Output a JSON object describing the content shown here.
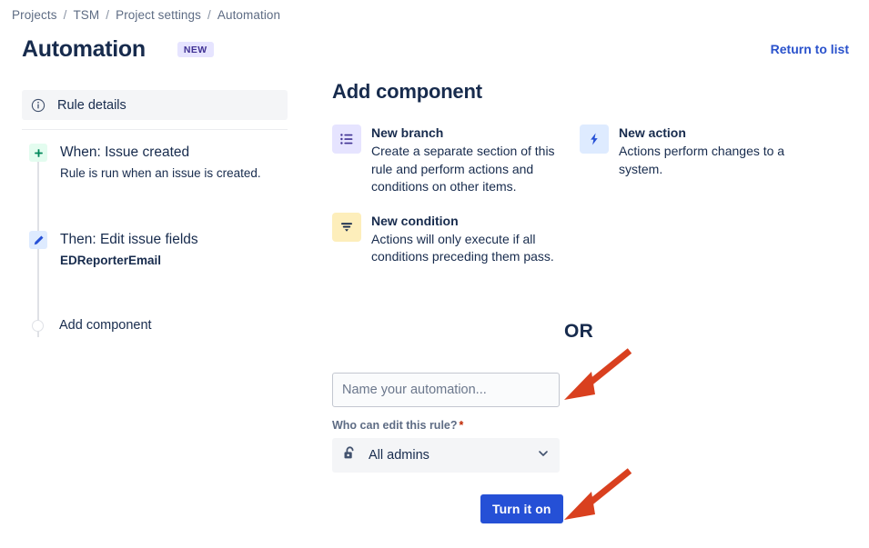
{
  "breadcrumb": {
    "items": [
      "Projects",
      "TSM",
      "Project settings",
      "Automation"
    ],
    "separator": "/"
  },
  "header": {
    "title": "Automation",
    "badge": "NEW",
    "return_link": "Return to list",
    "accent_link_color": "#2a52cc",
    "badge_bg": "#e6e4ff",
    "badge_fg": "#403294"
  },
  "left_panel": {
    "rule_details": {
      "label": "Rule details",
      "icon": "info-circle-icon"
    },
    "tree": [
      {
        "icon": "plus-icon",
        "badge_color": "#e3fcef",
        "title": "When: Issue created",
        "subtitle": "Rule is run when an issue is created.",
        "subtitle_bold": false
      },
      {
        "icon": "pencil-icon",
        "badge_color": "#deebff",
        "title": "Then: Edit issue fields",
        "subtitle": "EDReporterEmail",
        "subtitle_bold": true
      }
    ],
    "add_component_label": "Add component"
  },
  "right_panel": {
    "section_title": "Add component",
    "components": [
      {
        "name": "New branch",
        "description": "Create a separate section of this rule and perform actions and conditions on other items.",
        "icon": "list-branch-icon",
        "icon_bg": "#e6e4ff",
        "column": "left"
      },
      {
        "name": "New condition",
        "description": "Actions will only execute if all conditions preceding them pass.",
        "icon": "filter-funnel-icon",
        "icon_bg": "#fdeebb",
        "column": "left"
      },
      {
        "name": "New action",
        "description": "Actions perform changes to a system.",
        "icon": "lightning-bolt-icon",
        "icon_bg": "#deebff",
        "column": "right"
      }
    ],
    "or_label": "OR"
  },
  "form": {
    "name_input_placeholder": "Name your automation...",
    "name_input_value": "",
    "permission_label": "Who can edit this rule?",
    "required_marker": "*",
    "permission_value": "All admins",
    "permission_icon": "unlocked-padlock-icon",
    "submit_label": "Turn it on",
    "submit_color": "#2550d6"
  },
  "annotations": {
    "arrow_color": "#d9401f",
    "arrow_count": 2
  }
}
